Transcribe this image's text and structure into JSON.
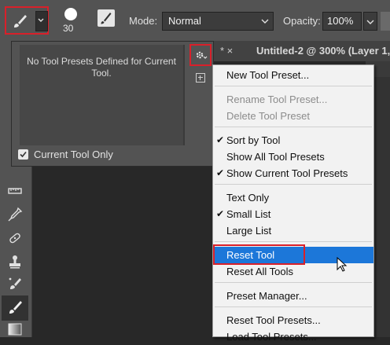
{
  "options_bar": {
    "brush_size": "30",
    "mode_label": "Mode:",
    "mode_value": "Normal",
    "opacity_label": "Opacity:",
    "opacity_value": "100%"
  },
  "document_tab": {
    "previous_tab_suffix": "* ×",
    "title": "Untitled-2 @ 300% (Layer 1,"
  },
  "presets_panel": {
    "empty_message": "No Tool Presets Defined for Current Tool.",
    "current_tool_only_label": "Current Tool Only",
    "current_tool_only_checked": true
  },
  "menu": {
    "items": [
      {
        "label": "New Tool Preset...",
        "checked": false,
        "enabled": true
      },
      {
        "label": "Rename Tool Preset...",
        "checked": false,
        "enabled": false
      },
      {
        "label": "Delete Tool Preset",
        "checked": false,
        "enabled": false
      },
      {
        "label": "Sort by Tool",
        "checked": true,
        "enabled": true
      },
      {
        "label": "Show All Tool Presets",
        "checked": false,
        "enabled": true
      },
      {
        "label": "Show Current Tool Presets",
        "checked": true,
        "enabled": true
      },
      {
        "label": "Text Only",
        "checked": false,
        "enabled": true
      },
      {
        "label": "Small List",
        "checked": true,
        "enabled": true
      },
      {
        "label": "Large List",
        "checked": false,
        "enabled": true
      },
      {
        "label": "Reset Tool",
        "checked": false,
        "enabled": true,
        "highlighted": true
      },
      {
        "label": "Reset All Tools",
        "checked": false,
        "enabled": true
      },
      {
        "label": "Preset Manager...",
        "checked": false,
        "enabled": true
      },
      {
        "label": "Reset Tool Presets...",
        "checked": false,
        "enabled": true
      },
      {
        "label": "Load Tool Presets...",
        "checked": false,
        "enabled": true
      }
    ]
  },
  "colors": {
    "highlight": "#1c77d9",
    "annotation_outline": "#d9202a"
  }
}
